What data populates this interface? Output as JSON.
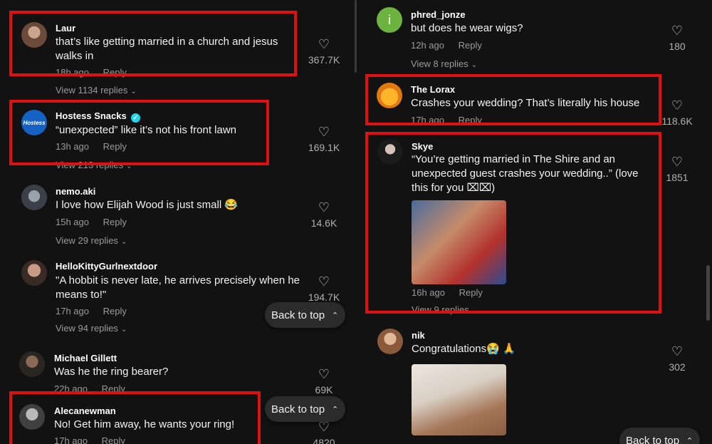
{
  "left": {
    "comments": [
      {
        "username": "Laur",
        "text": "that’s like getting married in a church and jesus walks in",
        "time": "18h ago",
        "reply": "Reply",
        "likes": "367.7K",
        "view_replies": "View 1134 replies"
      },
      {
        "username": "Hostess Snacks",
        "avatar_text": "Hostess",
        "text": "“unexpected” like it’s not his front lawn",
        "time": "13h ago",
        "reply": "Reply",
        "likes": "169.1K",
        "view_replies": "View 213 replies"
      },
      {
        "username": "nemo.aki",
        "text": "I love how Elijah Wood is just small 😂",
        "time": "15h ago",
        "reply": "Reply",
        "likes": "14.6K",
        "view_replies": "View 29 replies"
      },
      {
        "username": "HelloKittyGurlnextdoor",
        "text": "\"A hobbit is never late, he arrives precisely when he means to!\"",
        "time": "17h ago",
        "reply": "Reply",
        "likes": "194.7K",
        "view_replies": "View 94 replies"
      },
      {
        "username": "Michael Gillett",
        "text": "Was he the ring bearer?",
        "time": "22h ago",
        "reply": "Reply",
        "likes": "69K"
      },
      {
        "username": "Alecanewman",
        "text": "No! Get him away, he wants your ring!",
        "time": "17h ago",
        "reply": "Reply",
        "likes": "4820"
      }
    ]
  },
  "right": {
    "comments": [
      {
        "username": "phred_jonze",
        "avatar_text": "i",
        "text": "but does he wear wigs?",
        "time": "12h ago",
        "reply": "Reply",
        "likes": "180",
        "view_replies": "View 8 replies"
      },
      {
        "username": "The Lorax",
        "text": "Crashes your wedding? That’s literally his house",
        "time": "17h ago",
        "reply": "Reply",
        "likes": "118.6K"
      },
      {
        "username": "Skye",
        "text": "“You’re getting married in The Shire and an unexpected guest crashes your wedding..” (love this for you ⌧⌧)",
        "time": "16h ago",
        "reply": "Reply",
        "likes": "1851",
        "view_replies": "View 9 replies"
      },
      {
        "username": "nik",
        "text": "Congratulations😭 🙏",
        "likes": "302"
      }
    ]
  },
  "back_to_top": "Back to top",
  "colors": {
    "highlight": "#e01010",
    "background": "#121212",
    "muted": "#9a9a9a"
  }
}
